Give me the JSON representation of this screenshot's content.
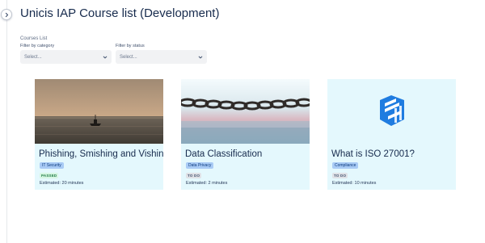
{
  "page": {
    "title": "Unicis IAP Course list (Development)"
  },
  "filters": {
    "section_label": "Courses List",
    "category": {
      "label": "Filter by category",
      "placeholder": "Select...",
      "icon": "chevron-down-icon"
    },
    "status": {
      "label": "Filter by status",
      "placeholder": "Select...",
      "icon": "chevron-down-icon"
    }
  },
  "sidebar": {
    "toggle_icon": "chevron-right-icon"
  },
  "colors": {
    "card_background": "#e4f8fd",
    "category_tag": "#a9cbf5",
    "passed_badge": "#d6f6e3",
    "todo_badge": "#dfe1e6",
    "logo_blue": "#1f7ce0"
  },
  "courses": [
    {
      "title": "Phishing, Smishing and Vishing",
      "category": "IT Security",
      "status": "PASSED",
      "estimated": "Estimated: 20 minutes",
      "image": "boat-at-sea-sunset-photo"
    },
    {
      "title": "Data Classification",
      "category": "Data Privacy",
      "status": "TO DO",
      "estimated": "Estimated: 2 minutes",
      "image": "chain-over-water-photo"
    },
    {
      "title": "What is ISO 27001?",
      "category": "Compliance",
      "status": "TO DO",
      "estimated": "Estimated: 10 minutes",
      "image": "unicis-logo-icon"
    }
  ]
}
